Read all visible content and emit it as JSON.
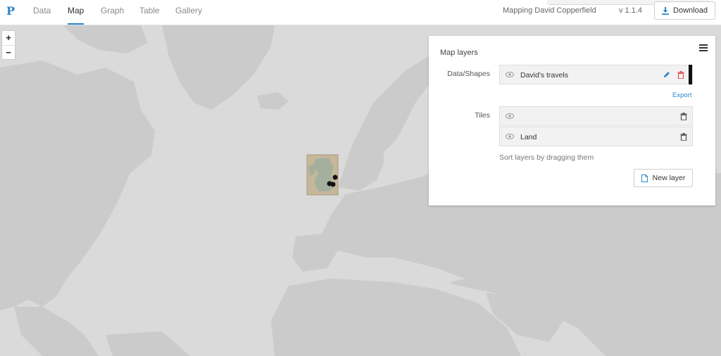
{
  "header": {
    "logo": "P",
    "tabs": [
      {
        "label": "Data",
        "active": false
      },
      {
        "label": "Map",
        "active": true
      },
      {
        "label": "Graph",
        "active": false
      },
      {
        "label": "Table",
        "active": false
      },
      {
        "label": "Gallery",
        "active": false
      }
    ],
    "project_title": "Mapping David Copperfield",
    "version": "v 1.1.4",
    "download_label": "Download"
  },
  "colors": {
    "accent": "#2a86c8",
    "logo": "#2a86c8",
    "active_tab_underline": "#2a86c8",
    "map_water": "#dadada",
    "map_land": "#cbcbcb",
    "delete_red": "#d9534f",
    "layer_color": "#111111"
  },
  "map": {
    "zoom_in_label": "+",
    "zoom_out_label": "−"
  },
  "layers_panel": {
    "title": "Map layers",
    "data_section_label": "Data/Shapes",
    "data_layers": [
      {
        "name": "David's travels",
        "icon": "eye-icon"
      }
    ],
    "export_label": "Export",
    "tiles_section_label": "Tiles",
    "tile_layers": [
      {
        "name": "",
        "icon": "eye-icon"
      },
      {
        "name": "Land",
        "icon": "eye-icon"
      }
    ],
    "sort_hint": "Sort layers by dragging them",
    "new_layer_label": "New layer"
  }
}
